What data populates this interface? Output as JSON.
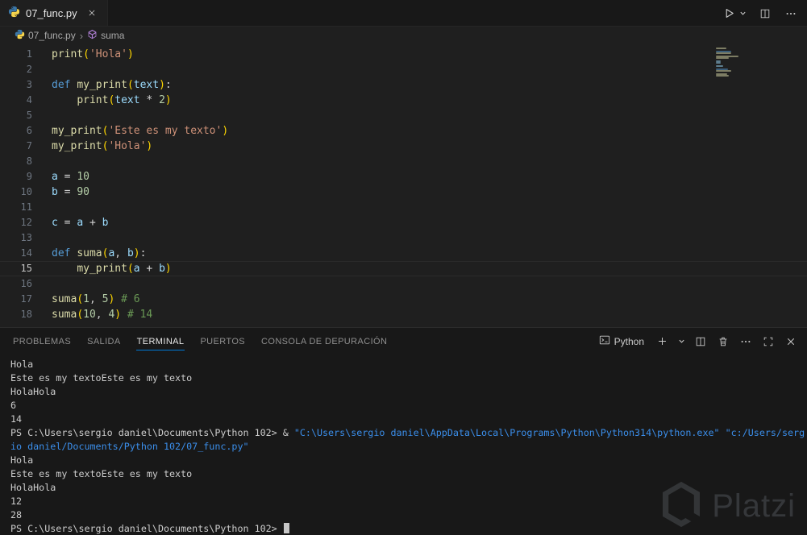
{
  "tab_bar": {
    "tab": {
      "filename": "07_func.py"
    }
  },
  "breadcrumb": {
    "file": "07_func.py",
    "separator": "›",
    "symbol": "suma"
  },
  "editor": {
    "token_colors": {
      "kw": "#569cd6",
      "func": "#dcdcaa",
      "str": "#ce9178",
      "num": "#b5cea8",
      "var": "#9cdcfe",
      "op": "#d4d4d4",
      "plain": "#cccccc",
      "com": "#6a9955",
      "brk": "#ffd700"
    },
    "lines": [
      {
        "num": 1,
        "tokens": [
          {
            "t": "print",
            "c": "func"
          },
          {
            "t": "(",
            "c": "brk"
          },
          {
            "t": "'Hola'",
            "c": "str"
          },
          {
            "t": ")",
            "c": "brk"
          }
        ]
      },
      {
        "num": 2,
        "tokens": []
      },
      {
        "num": 3,
        "tokens": [
          {
            "t": "def ",
            "c": "kw"
          },
          {
            "t": "my_print",
            "c": "func"
          },
          {
            "t": "(",
            "c": "brk"
          },
          {
            "t": "text",
            "c": "var"
          },
          {
            "t": ")",
            "c": "brk"
          },
          {
            "t": ":",
            "c": "op"
          }
        ]
      },
      {
        "num": 4,
        "tokens": [
          {
            "t": "    ",
            "c": "plain"
          },
          {
            "t": "print",
            "c": "func"
          },
          {
            "t": "(",
            "c": "brk"
          },
          {
            "t": "text",
            "c": "var"
          },
          {
            "t": " * ",
            "c": "op"
          },
          {
            "t": "2",
            "c": "num"
          },
          {
            "t": ")",
            "c": "brk"
          }
        ]
      },
      {
        "num": 5,
        "tokens": []
      },
      {
        "num": 6,
        "tokens": [
          {
            "t": "my_print",
            "c": "func"
          },
          {
            "t": "(",
            "c": "brk"
          },
          {
            "t": "'Este es my texto'",
            "c": "str"
          },
          {
            "t": ")",
            "c": "brk"
          }
        ]
      },
      {
        "num": 7,
        "tokens": [
          {
            "t": "my_print",
            "c": "func"
          },
          {
            "t": "(",
            "c": "brk"
          },
          {
            "t": "'Hola'",
            "c": "str"
          },
          {
            "t": ")",
            "c": "brk"
          }
        ]
      },
      {
        "num": 8,
        "tokens": []
      },
      {
        "num": 9,
        "tokens": [
          {
            "t": "a",
            "c": "var"
          },
          {
            "t": " = ",
            "c": "op"
          },
          {
            "t": "10",
            "c": "num"
          }
        ]
      },
      {
        "num": 10,
        "tokens": [
          {
            "t": "b",
            "c": "var"
          },
          {
            "t": " = ",
            "c": "op"
          },
          {
            "t": "90",
            "c": "num"
          }
        ]
      },
      {
        "num": 11,
        "tokens": []
      },
      {
        "num": 12,
        "tokens": [
          {
            "t": "c",
            "c": "var"
          },
          {
            "t": " = ",
            "c": "op"
          },
          {
            "t": "a",
            "c": "var"
          },
          {
            "t": " + ",
            "c": "op"
          },
          {
            "t": "b",
            "c": "var"
          }
        ]
      },
      {
        "num": 13,
        "tokens": []
      },
      {
        "num": 14,
        "tokens": [
          {
            "t": "def ",
            "c": "kw"
          },
          {
            "t": "suma",
            "c": "func"
          },
          {
            "t": "(",
            "c": "brk"
          },
          {
            "t": "a",
            "c": "var"
          },
          {
            "t": ", ",
            "c": "plain"
          },
          {
            "t": "b",
            "c": "var"
          },
          {
            "t": ")",
            "c": "brk"
          },
          {
            "t": ":",
            "c": "op"
          }
        ]
      },
      {
        "num": 15,
        "active": true,
        "tokens": [
          {
            "t": "    ",
            "c": "plain"
          },
          {
            "t": "my_print",
            "c": "func"
          },
          {
            "t": "(",
            "c": "brk"
          },
          {
            "t": "a",
            "c": "var"
          },
          {
            "t": " + ",
            "c": "op"
          },
          {
            "t": "b",
            "c": "var"
          },
          {
            "t": ")",
            "c": "brk"
          }
        ]
      },
      {
        "num": 16,
        "tokens": []
      },
      {
        "num": 17,
        "tokens": [
          {
            "t": "suma",
            "c": "func"
          },
          {
            "t": "(",
            "c": "brk"
          },
          {
            "t": "1",
            "c": "num"
          },
          {
            "t": ", ",
            "c": "plain"
          },
          {
            "t": "5",
            "c": "num"
          },
          {
            "t": ")",
            "c": "brk"
          },
          {
            "t": " ",
            "c": "plain"
          },
          {
            "t": "# 6",
            "c": "com"
          }
        ]
      },
      {
        "num": 18,
        "tokens": [
          {
            "t": "suma",
            "c": "func"
          },
          {
            "t": "(",
            "c": "brk"
          },
          {
            "t": "10",
            "c": "num"
          },
          {
            "t": ", ",
            "c": "plain"
          },
          {
            "t": "4",
            "c": "num"
          },
          {
            "t": ")",
            "c": "brk"
          },
          {
            "t": " ",
            "c": "plain"
          },
          {
            "t": "# 14",
            "c": "com"
          }
        ]
      }
    ]
  },
  "panel": {
    "tabs": [
      {
        "label": "PROBLEMAS",
        "active": false
      },
      {
        "label": "SALIDA",
        "active": false
      },
      {
        "label": "TERMINAL",
        "active": true
      },
      {
        "label": "PUERTOS",
        "active": false
      },
      {
        "label": "CONSOLA DE DEPURACIÓN",
        "active": false
      }
    ],
    "profile_label": "Python"
  },
  "terminal": {
    "colors": {
      "fg": "#cccccc",
      "blue": "#3b8eea"
    },
    "lines": [
      {
        "segs": [
          {
            "t": "Hola",
            "c": "fg"
          }
        ]
      },
      {
        "segs": [
          {
            "t": "Este es my textoEste es my texto",
            "c": "fg"
          }
        ]
      },
      {
        "segs": [
          {
            "t": "HolaHola",
            "c": "fg"
          }
        ]
      },
      {
        "segs": [
          {
            "t": "6",
            "c": "fg"
          }
        ]
      },
      {
        "segs": [
          {
            "t": "14",
            "c": "fg"
          }
        ]
      },
      {
        "segs": [
          {
            "t": "PS C:\\Users\\sergio daniel\\Documents\\Python 102> & ",
            "c": "fg"
          },
          {
            "t": "\"C:\\Users\\sergio daniel\\AppData\\Local\\Programs\\Python\\Python314\\python.exe\" \"c:/Users/serg",
            "c": "blue"
          }
        ]
      },
      {
        "segs": [
          {
            "t": "io daniel/Documents/Python 102/07_func.py\"",
            "c": "blue"
          }
        ]
      },
      {
        "segs": [
          {
            "t": "Hola",
            "c": "fg"
          }
        ]
      },
      {
        "segs": [
          {
            "t": "Este es my textoEste es my texto",
            "c": "fg"
          }
        ]
      },
      {
        "segs": [
          {
            "t": "HolaHola",
            "c": "fg"
          }
        ]
      },
      {
        "segs": [
          {
            "t": "12",
            "c": "fg"
          }
        ]
      },
      {
        "segs": [
          {
            "t": "28",
            "c": "fg"
          }
        ]
      },
      {
        "segs": [
          {
            "t": "PS C:\\Users\\sergio daniel\\Documents\\Python 102> ",
            "c": "fg"
          }
        ],
        "cursor": true
      }
    ]
  },
  "watermark": {
    "text": "Platzi"
  }
}
